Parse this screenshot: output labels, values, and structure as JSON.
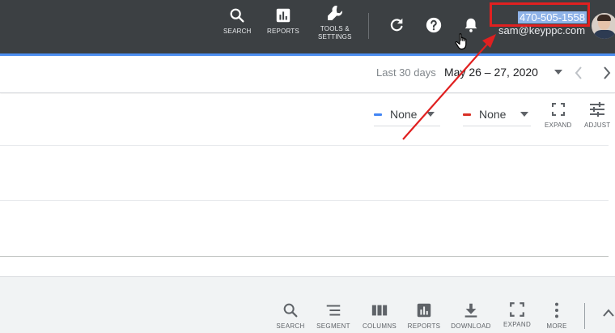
{
  "topbar": {
    "nav": [
      {
        "label": "SEARCH",
        "icon": "search-icon"
      },
      {
        "label": "REPORTS",
        "icon": "reports-icon"
      },
      {
        "label_line1": "TOOLS &",
        "label_line2": "SETTINGS",
        "icon": "wrench-icon"
      }
    ],
    "icons": [
      "refresh-icon",
      "help-icon",
      "bell-icon"
    ],
    "account": {
      "phone": "470-505-1558",
      "email": "sam@keyppc.com"
    }
  },
  "date_bar": {
    "range_label": "Last 30 days",
    "range_value": "May 26 – 27, 2020"
  },
  "chart_controls": {
    "metric1": {
      "label": "None",
      "color": "#4285f4"
    },
    "metric2": {
      "label": "None",
      "color": "#d93025"
    },
    "expand_label": "EXPAND",
    "adjust_label": "ADJUST"
  },
  "bottom_toolbar": [
    {
      "label": "SEARCH",
      "icon": "search-icon"
    },
    {
      "label": "SEGMENT",
      "icon": "segment-icon"
    },
    {
      "label": "COLUMNS",
      "icon": "columns-icon"
    },
    {
      "label": "REPORTS",
      "icon": "reports-icon"
    },
    {
      "label": "DOWNLOAD",
      "icon": "download-icon"
    },
    {
      "label": "EXPAND",
      "icon": "expand-icon"
    },
    {
      "label": "MORE",
      "icon": "more-icon"
    }
  ],
  "colors": {
    "topbar_bg": "#3c4043",
    "accent_blue": "#4d8ef0",
    "annotation_red": "#e02020",
    "bottombar_bg": "#f1f3f4"
  }
}
